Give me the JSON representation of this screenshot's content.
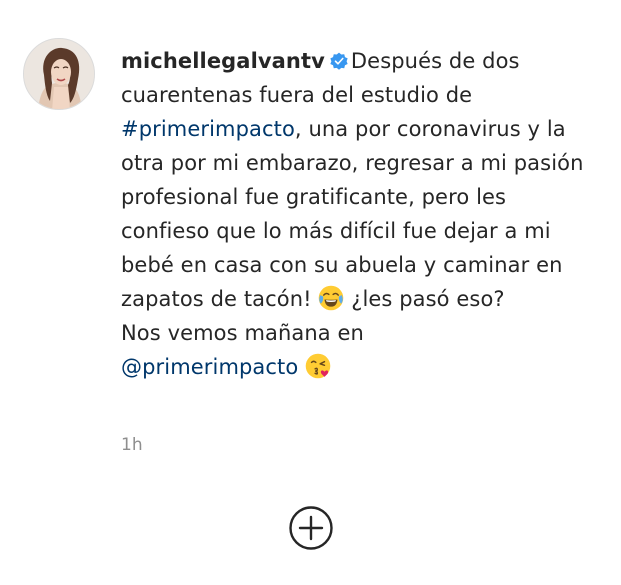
{
  "post": {
    "username": "michellegalvantv",
    "verified_icon": "verified-badge-icon",
    "caption_part1": "Después de dos cuarentenas fuera del estudio de ",
    "hashtag": "#primerimpacto",
    "caption_part2": ", una por coronavirus y la otra por mi embarazo, regresar a mi pasión profesional fue gratificante, pero les confieso que lo más difícil fue dejar a mi bebé en casa con su abuela y caminar en zapatos de tacón! ",
    "emoji_1": "face-with-tears-of-joy-emoji",
    "caption_part3": " ¿les pasó eso?",
    "caption_line_see_you": "Nos vemos mañana en",
    "mention": "@primerimpacto",
    "emoji_2": "face-blowing-kiss-emoji",
    "timestamp": "1h"
  },
  "actions": {
    "load_more_icon": "plus-circle-icon"
  },
  "colors": {
    "text": "#262626",
    "link": "#00376b",
    "muted": "#8e8e8e",
    "verified": "#3897f0"
  }
}
